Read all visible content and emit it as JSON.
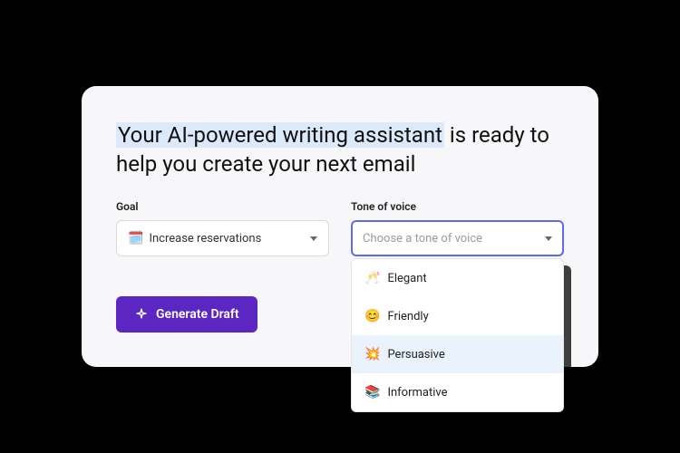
{
  "headline": {
    "highlighted": "Your AI-powered writing assistant",
    "rest": " is ready to help you create your next email"
  },
  "goal": {
    "label": "Goal",
    "emoji": "🗓️",
    "value": "Increase reservations"
  },
  "tone": {
    "label": "Tone of voice",
    "placeholder": "Choose a tone of voice",
    "options": [
      {
        "emoji": "🥂",
        "label": "Elegant"
      },
      {
        "emoji": "😊",
        "label": "Friendly"
      },
      {
        "emoji": "💥",
        "label": "Persuasive"
      },
      {
        "emoji": "📚",
        "label": "Informative"
      }
    ],
    "highlighted_index": 2
  },
  "button": {
    "label": "Generate Draft"
  }
}
